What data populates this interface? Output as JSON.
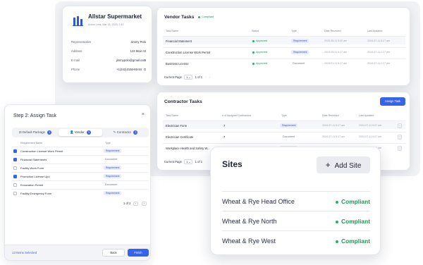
{
  "colors": {
    "accent": "#3563e9",
    "compliant": "#1a9a52",
    "tag_bg": "#e6ebff"
  },
  "vendor_card": {
    "name": "Allstar Supermarket",
    "active_since": "Active Less: Mar 18, 2025, 2:42",
    "rows": [
      {
        "label": "Representative",
        "value": "Jimmy Polo"
      },
      {
        "label": "Address",
        "value": "123 Main St"
      },
      {
        "label": "E-mail",
        "value": "jimmypolo@gmail.com"
      },
      {
        "label": "Phone",
        "value": "+1(342)3156-66-84"
      }
    ]
  },
  "vendor_tasks": {
    "title": "Vendor Tasks",
    "status": "Compliant",
    "columns": [
      "Task Name",
      "Status",
      "Type",
      "Date Received",
      "Last Updated"
    ],
    "rows": [
      {
        "name": "Financial Statement",
        "status": "Approved",
        "type": "Requirement",
        "type_style": "tag",
        "received": "2025-05-11 5:02 am",
        "updated": "2024-07-11 5:27 am"
      },
      {
        "name": "Construction License Work Permit",
        "status": "Approved",
        "type": "Requirement",
        "type_style": "tag",
        "received": "2024-05-11 5:27 am",
        "updated": "2024-07-11 2:27 pm"
      },
      {
        "name": "Business License",
        "status": "Approved",
        "type": "Document",
        "type_style": "plain",
        "received": "2024-01-11 5:27 am",
        "updated": "2024-07-11 2:27 pm"
      }
    ],
    "pager": {
      "label": "Current Page",
      "page": "1",
      "range": "1 of 1"
    }
  },
  "contractor_tasks": {
    "title": "Contractor Tasks",
    "assign_button": "Assign Task",
    "columns": [
      "Task Name",
      "# of Assigned Contractors",
      "Type",
      "Date Received",
      "Last Updated"
    ],
    "rows": [
      {
        "name": "Electrician Form",
        "count": "7",
        "type": "Requirement",
        "type_style": "tag",
        "received": "2024-07-11 5:27 am",
        "updated": "2024-07-11 5:27 am"
      },
      {
        "name": "Electrician Certificate",
        "count": "7",
        "type": "Document",
        "type_style": "plain",
        "received": "2024-07-11 5:27 am",
        "updated": "2024-07-11 5:27 am"
      },
      {
        "name": "Workplace Health and Safety W...",
        "count": "11",
        "type": "Requirement",
        "type_style": "tag",
        "received": "2024-07-11 5:27 am",
        "updated": "2024-07-11 5:27 am"
      }
    ],
    "pager": {
      "label": "Current Page",
      "page": "1",
      "range": "1 of 1"
    }
  },
  "assign_modal": {
    "title": "Step 2: Assign Task",
    "tabs": [
      {
        "label": "Default Package",
        "count": "3",
        "icon": "package-icon"
      },
      {
        "label": "Vendor",
        "count": "3",
        "icon": "user-icon"
      },
      {
        "label": "Contractor",
        "count": "3",
        "icon": "wrench-icon"
      }
    ],
    "columns": [
      "Requirement Name",
      "Type"
    ],
    "rows": [
      {
        "name": "Construction License Work Permit",
        "type": "Requirement",
        "type_style": "tag",
        "checked": true
      },
      {
        "name": "Financial Statements",
        "type": "Document",
        "type_style": "plain",
        "checked": true
      },
      {
        "name": "Facility Work Form",
        "type": "Requirement",
        "type_style": "tag",
        "checked": false
      },
      {
        "name": "Promotion License Upo",
        "type": "Requirement",
        "type_style": "tag",
        "checked": true
      },
      {
        "name": "Excavation Permit",
        "type": "Document",
        "type_style": "plain",
        "checked": false
      },
      {
        "name": "Facility Emergency Form",
        "type": "Requirement",
        "type_style": "tag",
        "checked": false
      }
    ],
    "pager": {
      "range": "1 of 2"
    },
    "selected_text": "13 Items Selected",
    "back_label": "Back",
    "next_label": "Finish"
  },
  "sites": {
    "title": "Sites",
    "add_label": "Add Site",
    "rows": [
      {
        "name": "Wheat & Rye Head Office",
        "status": "Compliant"
      },
      {
        "name": "Wheat & Rye North",
        "status": "Compliant"
      },
      {
        "name": "Wheat & Rye West",
        "status": "Compliant"
      }
    ]
  }
}
